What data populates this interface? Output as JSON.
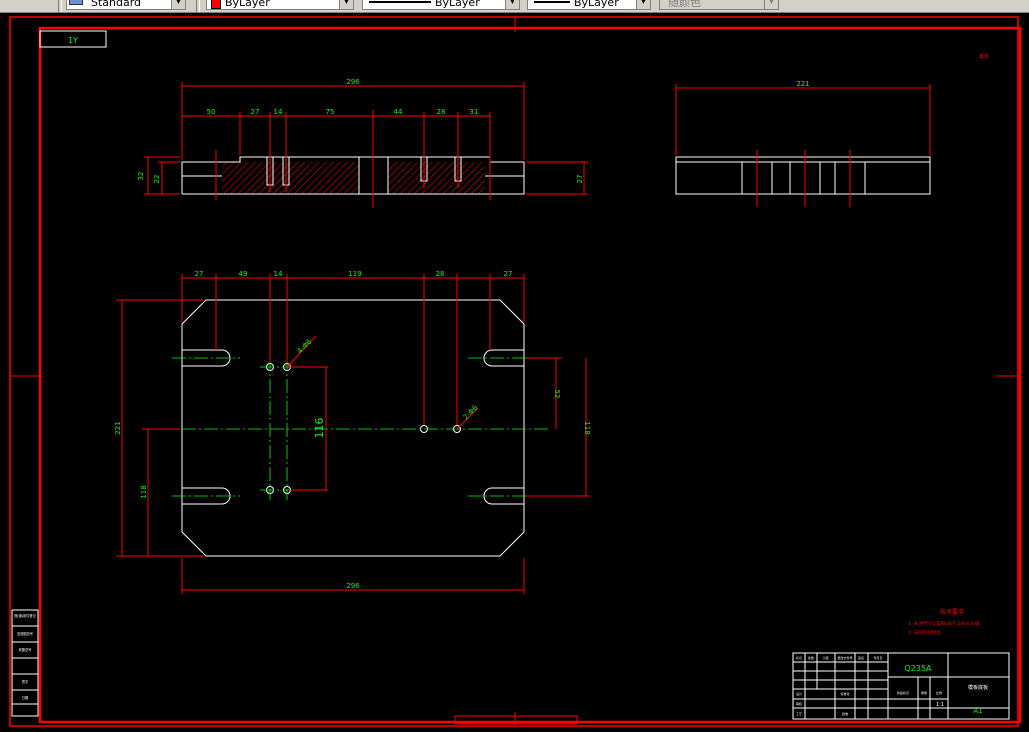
{
  "toolbar": {
    "text_style": "Standard",
    "color": "ByLayer",
    "linetype": "ByLayer",
    "lineweight": "ByLayer",
    "plot_style": "随颜色",
    "accent_color": "#ff0000"
  },
  "drawing": {
    "frame_tag": "1Y",
    "corner_mark": "其余",
    "front_view": {
      "overall_width": "296",
      "segments": [
        "50",
        "27",
        "14",
        "75",
        "44",
        "28",
        "31"
      ],
      "height_left": "32",
      "height_inner": "22",
      "height_right": "27"
    },
    "side_view": {
      "overall_width": "221"
    },
    "plan_view": {
      "top_segments": [
        "27",
        "49",
        "14",
        "119",
        "28",
        "27"
      ],
      "bottom_width": "296",
      "left_height": "221",
      "left_inner": "118",
      "right_inner": "52",
      "right_outer": "118",
      "center_dim": "116",
      "hole_note_1": "4-Φ6",
      "hole_note_2": "2-Φ6"
    },
    "tech_requirements": {
      "title": "技术要求",
      "lines": [
        "1. 未注尺寸公差按GB/T 1804-m级",
        "2. 去除毛刺锐边"
      ]
    },
    "title_block": {
      "material": "Q235A",
      "part_name": "模板底板",
      "size": "A1",
      "scale": "1:1",
      "labels": [
        "标记",
        "处数",
        "分区",
        "更改文件号",
        "签名",
        "年月日",
        "设计",
        "标准化",
        "审核",
        "工艺",
        "批准",
        "阶段标记",
        "重量",
        "比例"
      ]
    },
    "side_table": [
      "借(通)用件登记",
      "旧底图总号",
      "底图总号",
      "签字",
      "日期"
    ]
  }
}
